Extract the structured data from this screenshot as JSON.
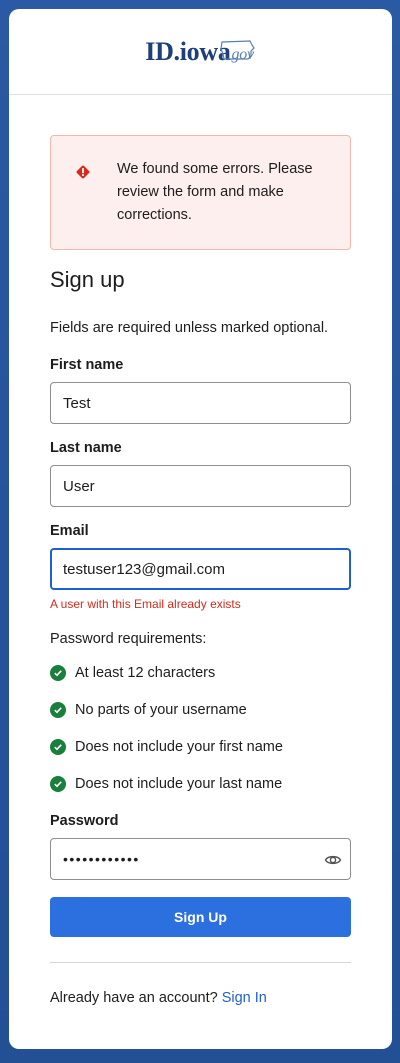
{
  "logo": {
    "main": "ID.iowa",
    "suffix": "gov"
  },
  "alert": {
    "message": "We found some errors. Please review the form and make corrections."
  },
  "form": {
    "title": "Sign up",
    "hint": "Fields are required unless marked optional.",
    "first_name": {
      "label": "First name",
      "value": "Test"
    },
    "last_name": {
      "label": "Last name",
      "value": "User"
    },
    "email": {
      "label": "Email",
      "value": "testuser123@gmail.com",
      "error": "A user with this Email already exists"
    },
    "password_requirements": {
      "title": "Password requirements:",
      "items": [
        "At least 12 characters",
        "No parts of your username",
        "Does not include your first name",
        "Does not include your last name"
      ]
    },
    "password": {
      "label": "Password",
      "value": "••••••••••••"
    },
    "submit_label": "Sign Up"
  },
  "footer": {
    "prompt": "Already have an account?",
    "link": "Sign In"
  },
  "colors": {
    "primary": "#2b70de",
    "error": "#d52b1e",
    "success": "#1a7f3c",
    "link": "#1f5fd6"
  }
}
